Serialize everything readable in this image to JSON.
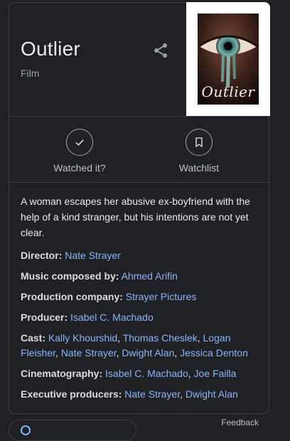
{
  "knowledge_panel": {
    "title": "Outlier",
    "subtitle": "Film",
    "poster_title": "Outlier",
    "share_icon": "share-icon",
    "actions": [
      {
        "label": "Watched it?",
        "icon": "check-icon"
      },
      {
        "label": "Watchlist",
        "icon": "bookmark-icon"
      }
    ],
    "description": "A woman escapes her abusive ex-boyfriend with the help of a kind stranger, but his intentions are not yet clear.",
    "facts": [
      {
        "key": "Director:",
        "values": [
          "Nate Strayer"
        ]
      },
      {
        "key": "Music composed by:",
        "values": [
          "Ahmed Arifin"
        ]
      },
      {
        "key": "Production company:",
        "values": [
          "Strayer Pictures"
        ]
      },
      {
        "key": "Producer:",
        "values": [
          "Isabel C. Machado"
        ]
      },
      {
        "key": "Cast:",
        "values": [
          "Kally Khourshid",
          "Thomas Cheslek",
          "Logan Fleisher",
          "Nate Strayer",
          "Dwight Alan",
          "Jessica Denton"
        ]
      },
      {
        "key": "Cinematography:",
        "values": [
          "Isabel C. Machado",
          "Joe Failla"
        ]
      },
      {
        "key": "Executive producers:",
        "values": [
          "Nate Strayer",
          "Dwight Alan"
        ]
      }
    ],
    "feedback_label": "Feedback"
  },
  "colors": {
    "background": "#202124",
    "border": "#3c4043",
    "link": "#8ab4f8",
    "text": "#e8eaed",
    "muted": "#9aa0a6"
  }
}
